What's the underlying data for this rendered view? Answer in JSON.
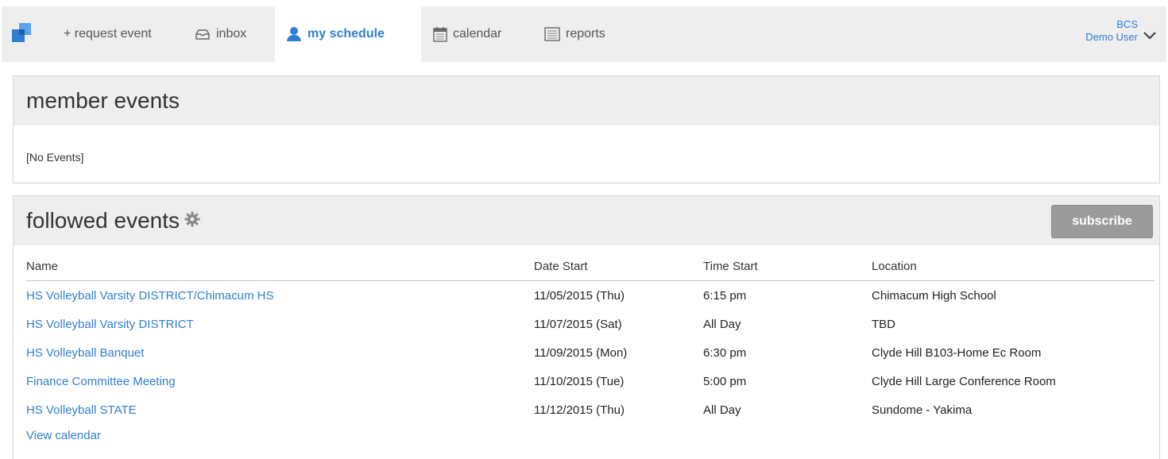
{
  "nav": {
    "request_label": "+ request event",
    "inbox_label": "inbox",
    "schedule_label": "my schedule",
    "calendar_label": "calendar",
    "reports_label": "reports",
    "active": "my schedule"
  },
  "user": {
    "org": "BCS",
    "name": "Demo User"
  },
  "member_events": {
    "title": "member events",
    "empty_text": "[No Events]"
  },
  "followed_events": {
    "title": "followed events",
    "subscribe_label": "subscribe",
    "columns": [
      "Name",
      "Date Start",
      "Time Start",
      "Location"
    ],
    "rows": [
      {
        "name": "HS Volleyball Varsity DISTRICT/Chimacum HS",
        "date": "11/05/2015 (Thu)",
        "time": "6:15 pm",
        "location": "Chimacum High School"
      },
      {
        "name": "HS Volleyball Varsity DISTRICT",
        "date": "11/07/2015 (Sat)",
        "time": "All Day",
        "location": "TBD"
      },
      {
        "name": "HS Volleyball Banquet",
        "date": "11/09/2015 (Mon)",
        "time": "6:30 pm",
        "location": "Clyde Hill B103-Home Ec Room"
      },
      {
        "name": "Finance Committee Meeting",
        "date": "11/10/2015 (Tue)",
        "time": "5:00 pm",
        "location": "Clyde Hill Large Conference Room"
      },
      {
        "name": "HS Volleyball STATE",
        "date": "11/12/2015 (Thu)",
        "time": "All Day",
        "location": "Sundome - Yakima"
      }
    ],
    "view_calendar_label": "View calendar"
  },
  "colors": {
    "accent": "#2f7fd0",
    "header_bg": "#eeeeee",
    "button_bg": "#9b9b9b"
  },
  "icons": [
    "logo-icon",
    "inbox-icon",
    "user-icon",
    "calendar-icon",
    "reports-icon",
    "gear-icon",
    "chevron-down-icon"
  ]
}
